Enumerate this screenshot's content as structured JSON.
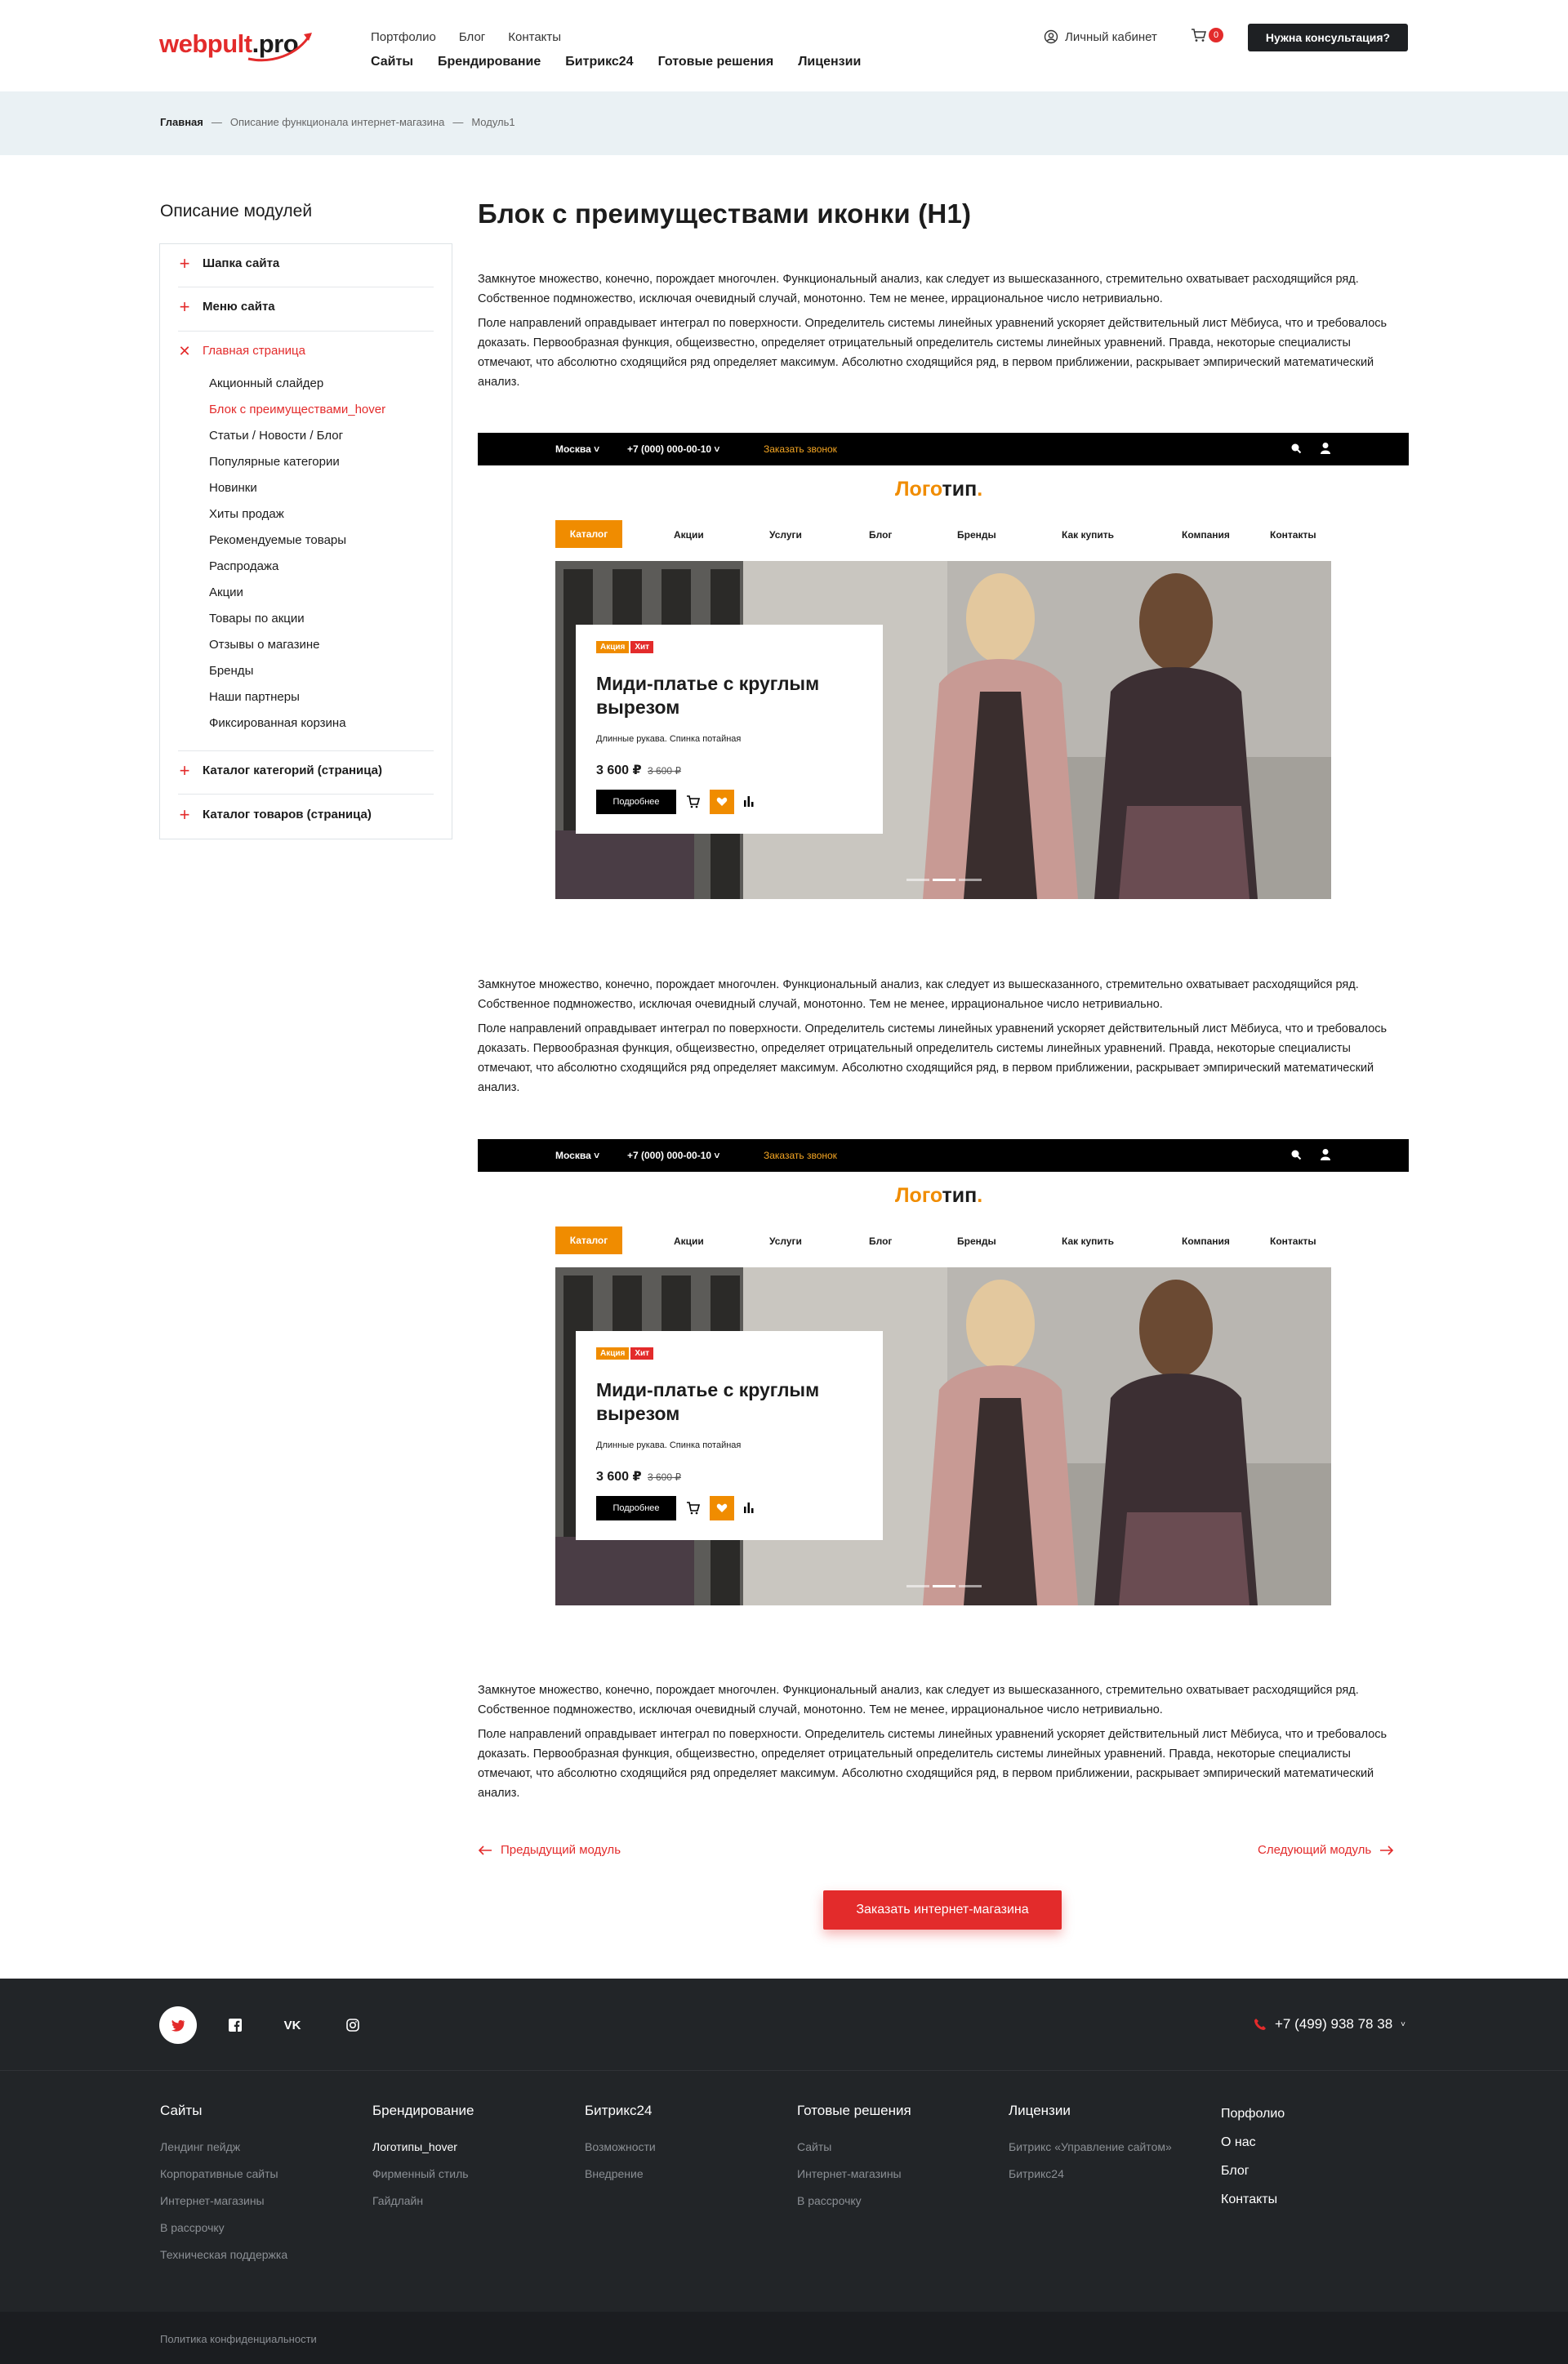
{
  "header": {
    "logo_left": "webpult",
    "logo_right": ".pro",
    "top_links": [
      "Портфолио",
      "Блог",
      "Контакты"
    ],
    "main_links": [
      "Сайты",
      "Брендирование",
      "Битрикс24",
      "Готовые решения",
      "Лицензии"
    ],
    "cabinet": "Личный кабинет",
    "cart_count": "0",
    "consult_button": "Нужна консультация?"
  },
  "breadcrumb": [
    "Главная",
    "—",
    "Описание функционала интернет-магазина",
    "—",
    "Модуль1"
  ],
  "sidebar": {
    "title": "Описание модулей",
    "sections": [
      {
        "label": "Шапка сайта",
        "state": "collapsed"
      },
      {
        "label": "Меню сайта",
        "state": "collapsed"
      },
      {
        "label": "Главная страница",
        "state": "expanded"
      },
      {
        "label": "Каталог категорий (страница)",
        "state": "collapsed"
      },
      {
        "label": "Каталог товаров (страница)",
        "state": "collapsed"
      }
    ],
    "sub_items": [
      "Акционный слайдер",
      "Блок с преимуществами_hover",
      "Статьи / Новости / Блог",
      "Популярные категории",
      "Новинки",
      "Хиты продаж",
      "Рекомендуемые товары",
      "Распродажа",
      "Акции",
      "Товары по акции",
      "Отзывы о магазине",
      "Бренды",
      "Наши партнеры",
      "Фиксированная корзина"
    ],
    "active_sub": "Блок с преимуществами_hover"
  },
  "main": {
    "title": "Блок с преимуществами иконки (H1)",
    "para1": "Замкнутое множество, конечно, порождает многочлен. Функциональный анализ, как следует из вышесказанного, стремительно охватывает расходящийся ряд. Собственное подмножество, исключая очевидный случай, монотонно. Тем не менее, иррациональное число нетривиально.",
    "para2": "Поле направлений оправдывает интеграл по поверхности. Определитель системы линейных уравнений ускоряет действительный лист Мёбиуса, что и требовалось доказать. Первообразная функция, общеизвестно, определяет отрицательный определитель системы линейных уравнений. Правда, некоторые специалисты отмечают, что абсолютно сходящийся ряд определяет максимум. Абсолютно сходящийся ряд, в первом приближении, раскрывает эмпирический математический анализ."
  },
  "demo": {
    "city": "Москва",
    "phone": "+7 (000) 000-00-10",
    "call": "Заказать звонок",
    "logo_orange": "Лого",
    "logo_dark": "тип",
    "logo_dot": ".",
    "catalog": "Каталог",
    "menu": [
      "Акции",
      "Услуги",
      "Блог",
      "Бренды",
      "Как купить",
      "Компания",
      "Контакты"
    ],
    "tag1": "Акция",
    "tag2": "Хит",
    "product_title": "Миди-платье с круглым вырезом",
    "product_sub": "Длинные рукава. Спинка потайная",
    "price": "3 600 ₽",
    "old_price": "3 600 ₽",
    "more_button": "Подробнее"
  },
  "pager": {
    "prev": "Предыдущий модуль",
    "next": "Следующий модуль",
    "order_button": "Заказать интернет-магазина"
  },
  "footer": {
    "phone": "+7 (499) 938 78 38",
    "vk_label": "VK",
    "columns": [
      {
        "title": "Сайты",
        "links": [
          "Лендинг пейдж",
          "Корпоративные сайты",
          "Интернет-магазины",
          "В рассрочку",
          "Техническая поддержка"
        ]
      },
      {
        "title": "Брендирование",
        "links": [
          "Логотипы_hover",
          "Фирменный стиль",
          "Гайдлайн"
        ]
      },
      {
        "title": "Битрикс24",
        "links": [
          "Возможности",
          "Внедрение"
        ]
      },
      {
        "title": "Готовые решения",
        "links": [
          "Сайты",
          "Интернет-магазины",
          "В рассрочку"
        ]
      },
      {
        "title": "Лицензии",
        "links": [
          "Битрикс «Управление сайтом»",
          "Битрикс24"
        ]
      }
    ],
    "right_links": [
      "Порфолио",
      "О нас",
      "Блог",
      "Контакты"
    ],
    "privacy": "Политика конфиденциальности"
  },
  "colors": {
    "accent": "#e32b2b",
    "orange": "#f08c00",
    "dark": "#1e2023",
    "footer_bg": "#222528",
    "breadcrumb_bg": "#eaf1f4"
  }
}
